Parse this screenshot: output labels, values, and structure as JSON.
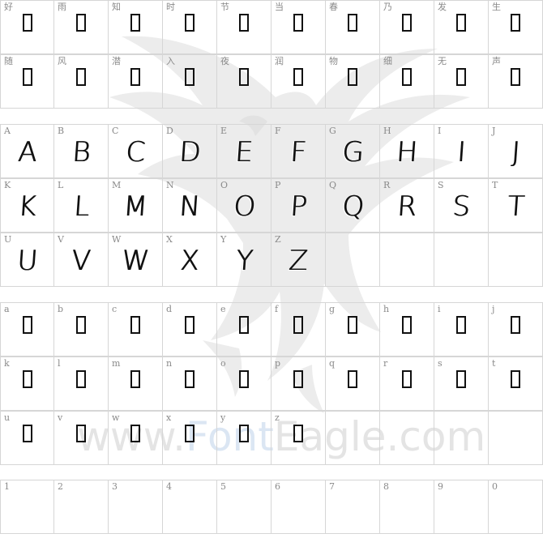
{
  "cjk": [
    "好",
    "雨",
    "知",
    "时",
    "节",
    "当",
    "春",
    "乃",
    "发",
    "生",
    "随",
    "风",
    "潜",
    "入",
    "夜",
    "润",
    "物",
    "细",
    "无",
    "声"
  ],
  "upper": [
    "A",
    "B",
    "C",
    "D",
    "E",
    "F",
    "G",
    "H",
    "I",
    "J",
    "K",
    "L",
    "M",
    "N",
    "O",
    "P",
    "Q",
    "R",
    "S",
    "T",
    "U",
    "V",
    "W",
    "X",
    "Y",
    "Z"
  ],
  "lower": [
    "a",
    "b",
    "c",
    "d",
    "e",
    "f",
    "g",
    "h",
    "i",
    "j",
    "k",
    "l",
    "m",
    "n",
    "o",
    "p",
    "q",
    "r",
    "s",
    "t",
    "u",
    "v",
    "w",
    "x",
    "y",
    "z"
  ],
  "digits": [
    "1",
    "2",
    "3",
    "4",
    "5",
    "6",
    "7",
    "8",
    "9",
    "0"
  ],
  "watermark": {
    "prefix": "www.",
    "brand": "Font",
    "suffix": "Eagle.com"
  },
  "colors": {
    "grid_line": "#d6d6d6",
    "label": "#8a8a8a",
    "glyph": "#111111",
    "watermark": "#e4e4e4"
  }
}
